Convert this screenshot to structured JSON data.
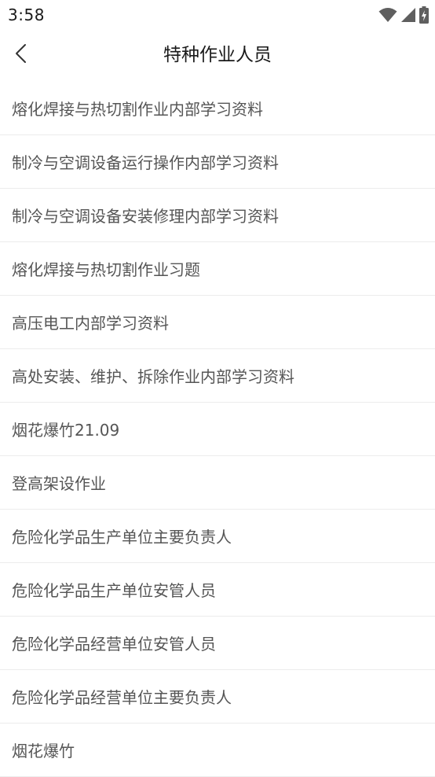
{
  "status_bar": {
    "time": "3:58",
    "icons": [
      "wifi-icon",
      "cellular-signal-icon",
      "battery-charging-icon"
    ]
  },
  "app_bar": {
    "title": "特种作业人员",
    "back_icon": "chevron-left-icon"
  },
  "list": {
    "items": [
      {
        "label": "熔化焊接与热切割作业内部学习资料"
      },
      {
        "label": "制冷与空调设备运行操作内部学习资料"
      },
      {
        "label": "制冷与空调设备安装修理内部学习资料"
      },
      {
        "label": "熔化焊接与热切割作业习题"
      },
      {
        "label": "高压电工内部学习资料"
      },
      {
        "label": "高处安装、维护、拆除作业内部学习资料"
      },
      {
        "label": "烟花爆竹21.09"
      },
      {
        "label": "登高架设作业"
      },
      {
        "label": "危险化学品生产单位主要负责人"
      },
      {
        "label": "危险化学品生产单位安管人员"
      },
      {
        "label": "危险化学品经营单位安管人员"
      },
      {
        "label": "危险化学品经营单位主要负责人"
      },
      {
        "label": "烟花爆竹"
      }
    ]
  },
  "colors": {
    "background": "#ffffff",
    "title_text": "#1a1a1a",
    "item_text": "#555555",
    "divider": "#ececec"
  }
}
